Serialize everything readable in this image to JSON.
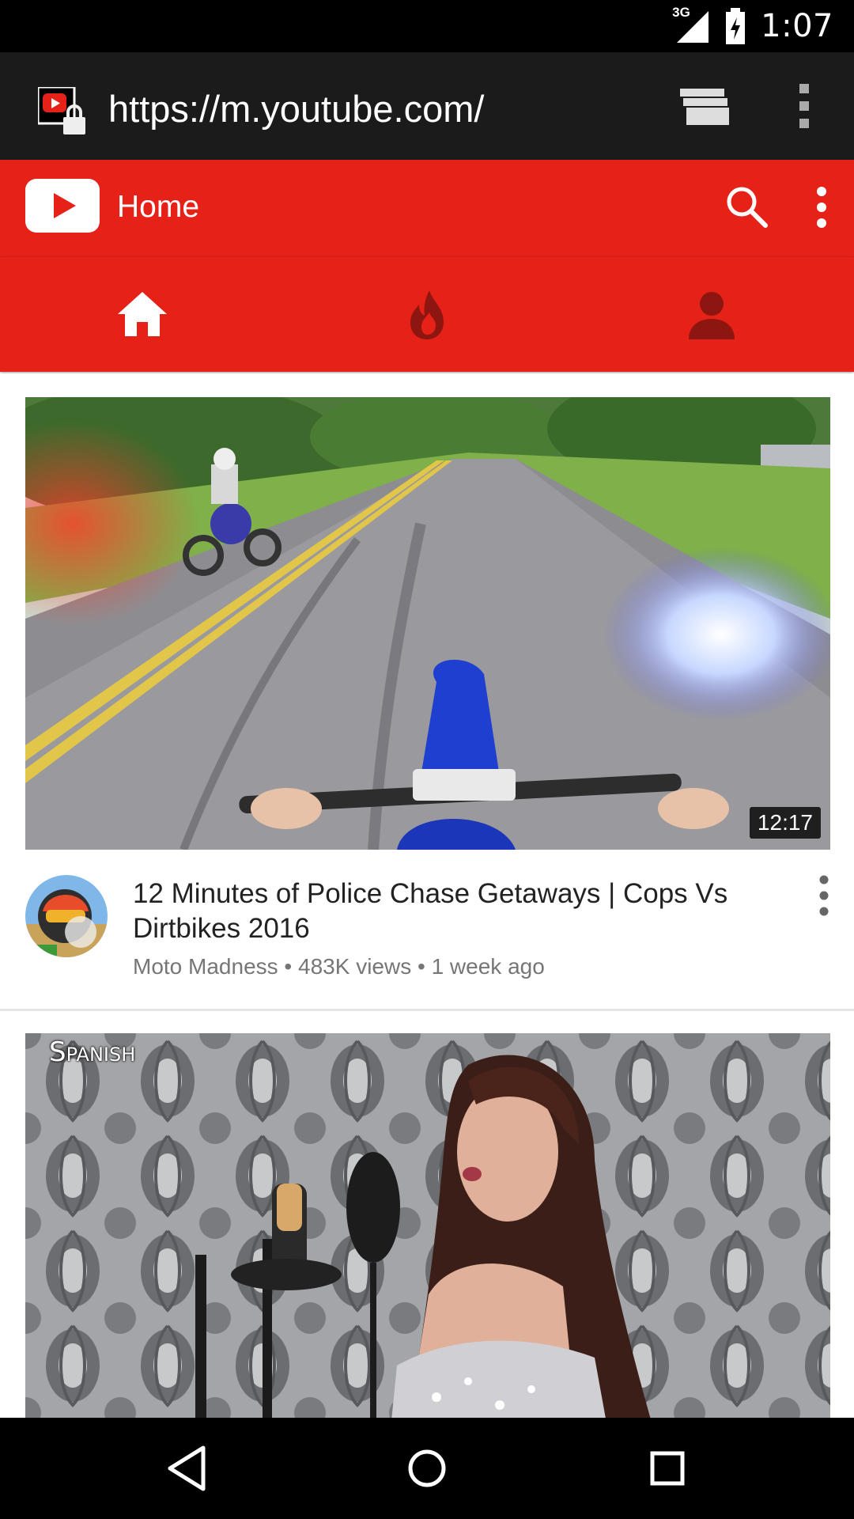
{
  "status_bar": {
    "network_type": "3G",
    "time": "1:07",
    "icons": [
      "signal-icon",
      "battery-charging-icon"
    ]
  },
  "browser": {
    "url": "https://m.youtube.com/",
    "icons": [
      "site-secure-icon",
      "tabs-switcher-icon",
      "browser-menu-icon"
    ]
  },
  "header": {
    "title": "Home",
    "brand_color": "#e62117",
    "icons": [
      "youtube-logo-icon",
      "search-icon",
      "overflow-menu-icon"
    ]
  },
  "pivot_bar": {
    "tabs": [
      {
        "name": "home",
        "icon": "home-icon",
        "selected": true
      },
      {
        "name": "trending",
        "icon": "flame-icon",
        "selected": false
      },
      {
        "name": "account",
        "icon": "person-icon",
        "selected": false
      }
    ]
  },
  "feed": {
    "videos": [
      {
        "duration": "12:17",
        "title": "12 Minutes of Police Chase Getaways | Cops Vs Dirtbikes 2016",
        "channel": "Moto Madness",
        "views": "483K views",
        "age": "1 week ago",
        "separator": " • "
      },
      {
        "thumbnail_tag": "Spanish"
      }
    ]
  },
  "nav_bar": {
    "icons": [
      "back-icon",
      "home-circle-icon",
      "recents-icon"
    ]
  }
}
